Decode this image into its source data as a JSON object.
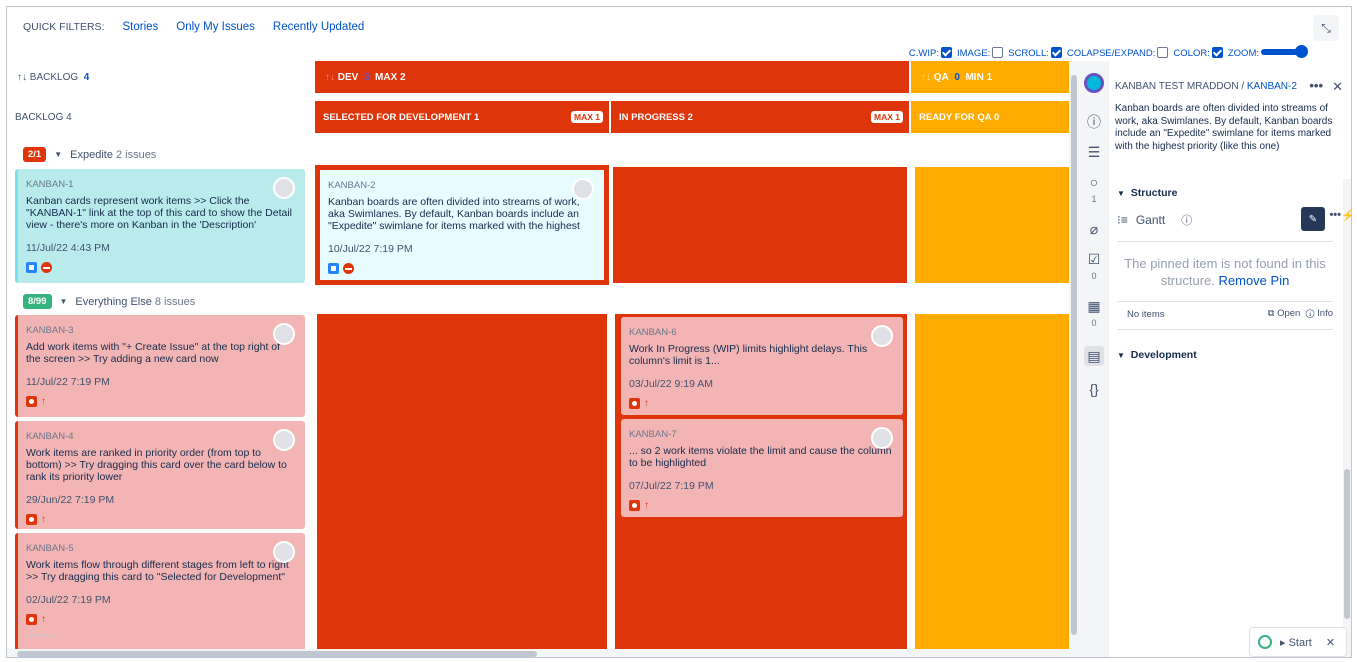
{
  "quick_filters": {
    "label": "QUICK FILTERS:",
    "items": [
      "Stories",
      "Only My Issues",
      "Recently Updated"
    ]
  },
  "board_options": {
    "cwip": "C.WIP:",
    "image": "IMAGE:",
    "scroll": "SCROLL:",
    "collapse": "COLAPSE/EXPAND:",
    "color": "COLOR:",
    "zoom": "ZOOM:"
  },
  "columns_top": {
    "backlog": {
      "arrows": "↑↓",
      "label": "BACKLOG",
      "count": "4"
    },
    "dev": {
      "arrows": "↑↓",
      "label": "DEV",
      "count": "3",
      "limit": "MAX 2"
    },
    "qa": {
      "arrows": "↑↓",
      "label": "QA",
      "count": "0",
      "limit": "MIN 1"
    }
  },
  "columns_sub": {
    "backlog": "BACKLOG 4",
    "selected": "SELECTED FOR DEVELOPMENT 1",
    "selected_max": "MAX 1",
    "in_progress": "IN PROGRESS 2",
    "in_progress_max": "MAX 1",
    "ready_qa": "READY FOR QA 0"
  },
  "swimlanes": {
    "expedite": {
      "badge": "2/1",
      "name": "Expedite",
      "count": "2 issues",
      "color": "#de350b"
    },
    "else": {
      "badge": "8/99",
      "name": "Everything Else",
      "count": "8 issues",
      "color": "#36b37e"
    }
  },
  "cards": {
    "k1": {
      "key": "KANBAN-1",
      "summary": "Kanban cards represent work items >> Click the \"KANBAN-1\" link at the top of this card to show the Detail view - there's more on Kanban in the 'Description'",
      "date": "11/Jul/22 4:43 PM"
    },
    "k2": {
      "key": "KANBAN-2",
      "summary": "Kanban boards are often divided into streams of work, aka Swimlanes. By default, Kanban boards include an \"Expedite\" swimlane for items marked with the highest",
      "date": "10/Jul/22 7:19 PM"
    },
    "k3": {
      "key": "KANBAN-3",
      "summary": "Add work items with \"+ Create Issue\" at the top right of the screen >> Try adding a new card now",
      "date": "11/Jul/22 7:19 PM"
    },
    "k4": {
      "key": "KANBAN-4",
      "summary": "Work items are ranked in priority order (from top to bottom) >> Try dragging this card over the card below to rank its priority lower",
      "date": "29/Jun/22 7:19 PM"
    },
    "k5": {
      "key": "KANBAN-5",
      "summary": "Work items flow through different stages from left to right >> Try dragging this card to \"Selected for Development\"",
      "date": "02/Jul/22 7:19 PM"
    },
    "k6": {
      "key": "KANBAN-6",
      "summary": "Work In Progress (WIP) limits highlight delays. This column's limit is 1...",
      "date": "03/Jul/22 9:19 AM"
    },
    "k7": {
      "key": "KANBAN-7",
      "summary": "... so 2 work items violate the limit and cause the column to be highlighted",
      "date": "07/Jul/22 7:19 PM"
    }
  },
  "rail": {
    "comments_count": "1",
    "checklist_count": "0",
    "table_count": "0"
  },
  "detail": {
    "project": "KANBAN TEST MRADDON",
    "separator": " / ",
    "issue": "KANBAN-2",
    "description": "Kanban boards are often divided into streams of work, aka Swimlanes. By default, Kanban boards include an \"Expedite\" swimlane for items marked with the highest priority (like this one)",
    "structure_label": "Structure",
    "gantt_label": "Gantt",
    "not_found": "The pinned item is not found in this structure.",
    "remove_pin": "Remove Pin",
    "no_items": "No items",
    "open": "Open",
    "info": "Info",
    "development_label": "Development"
  },
  "start_widget": {
    "label": "Start"
  },
  "colors": {
    "dev_red": "#de350b",
    "qa_orange": "#ffab00",
    "link_blue": "#0052cc"
  }
}
